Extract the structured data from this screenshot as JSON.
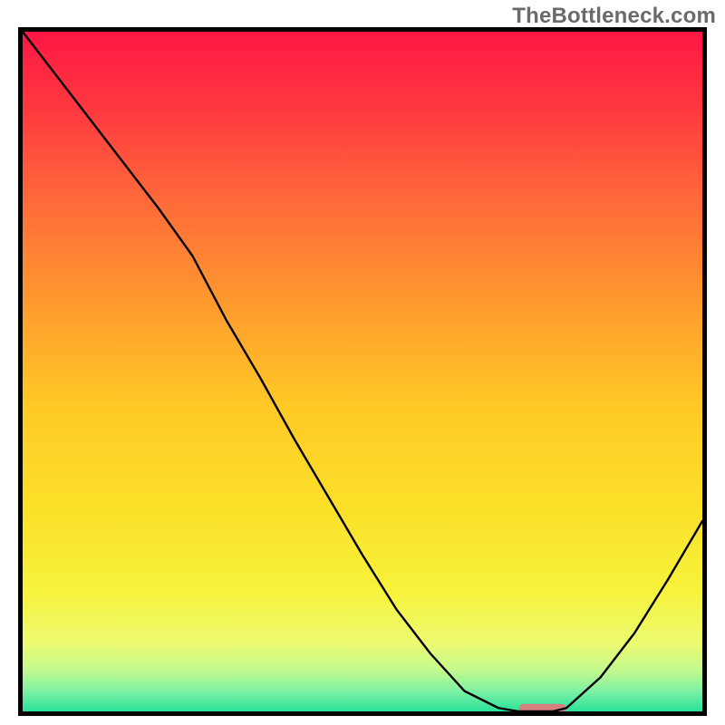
{
  "watermark": "TheBottleneck.com",
  "chart_data": {
    "type": "line",
    "title": "",
    "xlabel": "",
    "ylabel": "",
    "x": [
      0.0,
      0.05,
      0.1,
      0.15,
      0.2,
      0.25,
      0.3,
      0.35,
      0.4,
      0.45,
      0.5,
      0.55,
      0.6,
      0.65,
      0.7,
      0.73,
      0.78,
      0.8,
      0.85,
      0.9,
      0.95,
      1.0
    ],
    "y": [
      1.0,
      0.935,
      0.87,
      0.805,
      0.74,
      0.67,
      0.575,
      0.49,
      0.4,
      0.315,
      0.23,
      0.15,
      0.085,
      0.03,
      0.005,
      0.0,
      0.0,
      0.005,
      0.05,
      0.115,
      0.195,
      0.28
    ],
    "xlim": [
      0,
      1
    ],
    "ylim": [
      0,
      1
    ],
    "marker": {
      "x_start": 0.73,
      "x_end": 0.8,
      "y": 0.003
    },
    "background_gradient": {
      "stops": [
        {
          "offset": 0.0,
          "color": "#ff1744"
        },
        {
          "offset": 0.12,
          "color": "#ff3b3f"
        },
        {
          "offset": 0.25,
          "color": "#ff6a3a"
        },
        {
          "offset": 0.4,
          "color": "#ff9a2e"
        },
        {
          "offset": 0.55,
          "color": "#ffc926"
        },
        {
          "offset": 0.7,
          "color": "#fbe029"
        },
        {
          "offset": 0.82,
          "color": "#f7f23a"
        },
        {
          "offset": 0.9,
          "color": "#ecfb71"
        },
        {
          "offset": 0.94,
          "color": "#c2f98e"
        },
        {
          "offset": 0.97,
          "color": "#7ef1a4"
        },
        {
          "offset": 1.0,
          "color": "#28e29a"
        }
      ]
    }
  }
}
